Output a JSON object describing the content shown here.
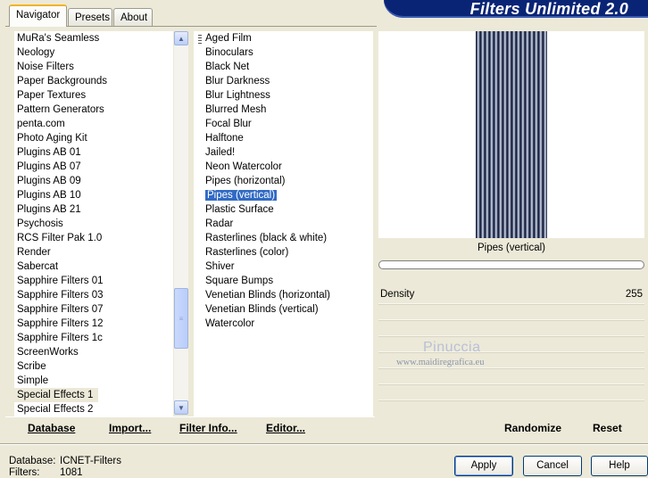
{
  "tabs": [
    {
      "label": "Navigator"
    },
    {
      "label": "Presets"
    },
    {
      "label": "About"
    }
  ],
  "app_title": "Filters Unlimited 2.0",
  "categories": [
    "MuRa's Seamless",
    "Neology",
    "Noise Filters",
    "Paper Backgrounds",
    "Paper Textures",
    "Pattern Generators",
    "penta.com",
    "Photo Aging Kit",
    "Plugins AB 01",
    "Plugins AB 07",
    "Plugins AB 09",
    "Plugins AB 10",
    "Plugins AB 21",
    "Psychosis",
    "RCS Filter Pak 1.0",
    "Render",
    "Sabercat",
    "Sapphire Filters 01",
    "Sapphire Filters 03",
    "Sapphire Filters 07",
    "Sapphire Filters 12",
    "Sapphire Filters 1c",
    "ScreenWorks",
    "Scribe",
    "Simple",
    "Special Effects 1",
    "Special Effects 2"
  ],
  "selected_category": "Special Effects 1",
  "filters": [
    "Aged Film",
    "Binoculars",
    "Black Net",
    "Blur Darkness",
    "Blur Lightness",
    "Blurred Mesh",
    "Focal Blur",
    "Halftone",
    "Jailed!",
    "Neon Watercolor",
    "Pipes (horizontal)",
    "Pipes (vertical)",
    "Plastic Surface",
    "Radar",
    "Rasterlines (black & white)",
    "Rasterlines (color)",
    "Shiver",
    "Square Bumps",
    "Venetian Blinds (horizontal)",
    "Venetian Blinds (vertical)",
    "Watercolor"
  ],
  "selected_filter": "Pipes (vertical)",
  "preview": {
    "filter_name": "Pipes (vertical)",
    "params": [
      {
        "name": "Density",
        "value": "255"
      }
    ],
    "watermark_name": "Pinuccia",
    "watermark_url": "www.maidiregrafica.eu"
  },
  "toolbar": {
    "database": "Database",
    "import": "Import...",
    "filter_info": "Filter Info...",
    "editor": "Editor...",
    "randomize": "Randomize",
    "reset": "Reset"
  },
  "status": {
    "database_label": "Database:",
    "database_value": "ICNET-Filters",
    "filters_label": "Filters:",
    "filters_value": "1081"
  },
  "buttons": {
    "apply": "Apply",
    "cancel": "Cancel",
    "help": "Help"
  }
}
